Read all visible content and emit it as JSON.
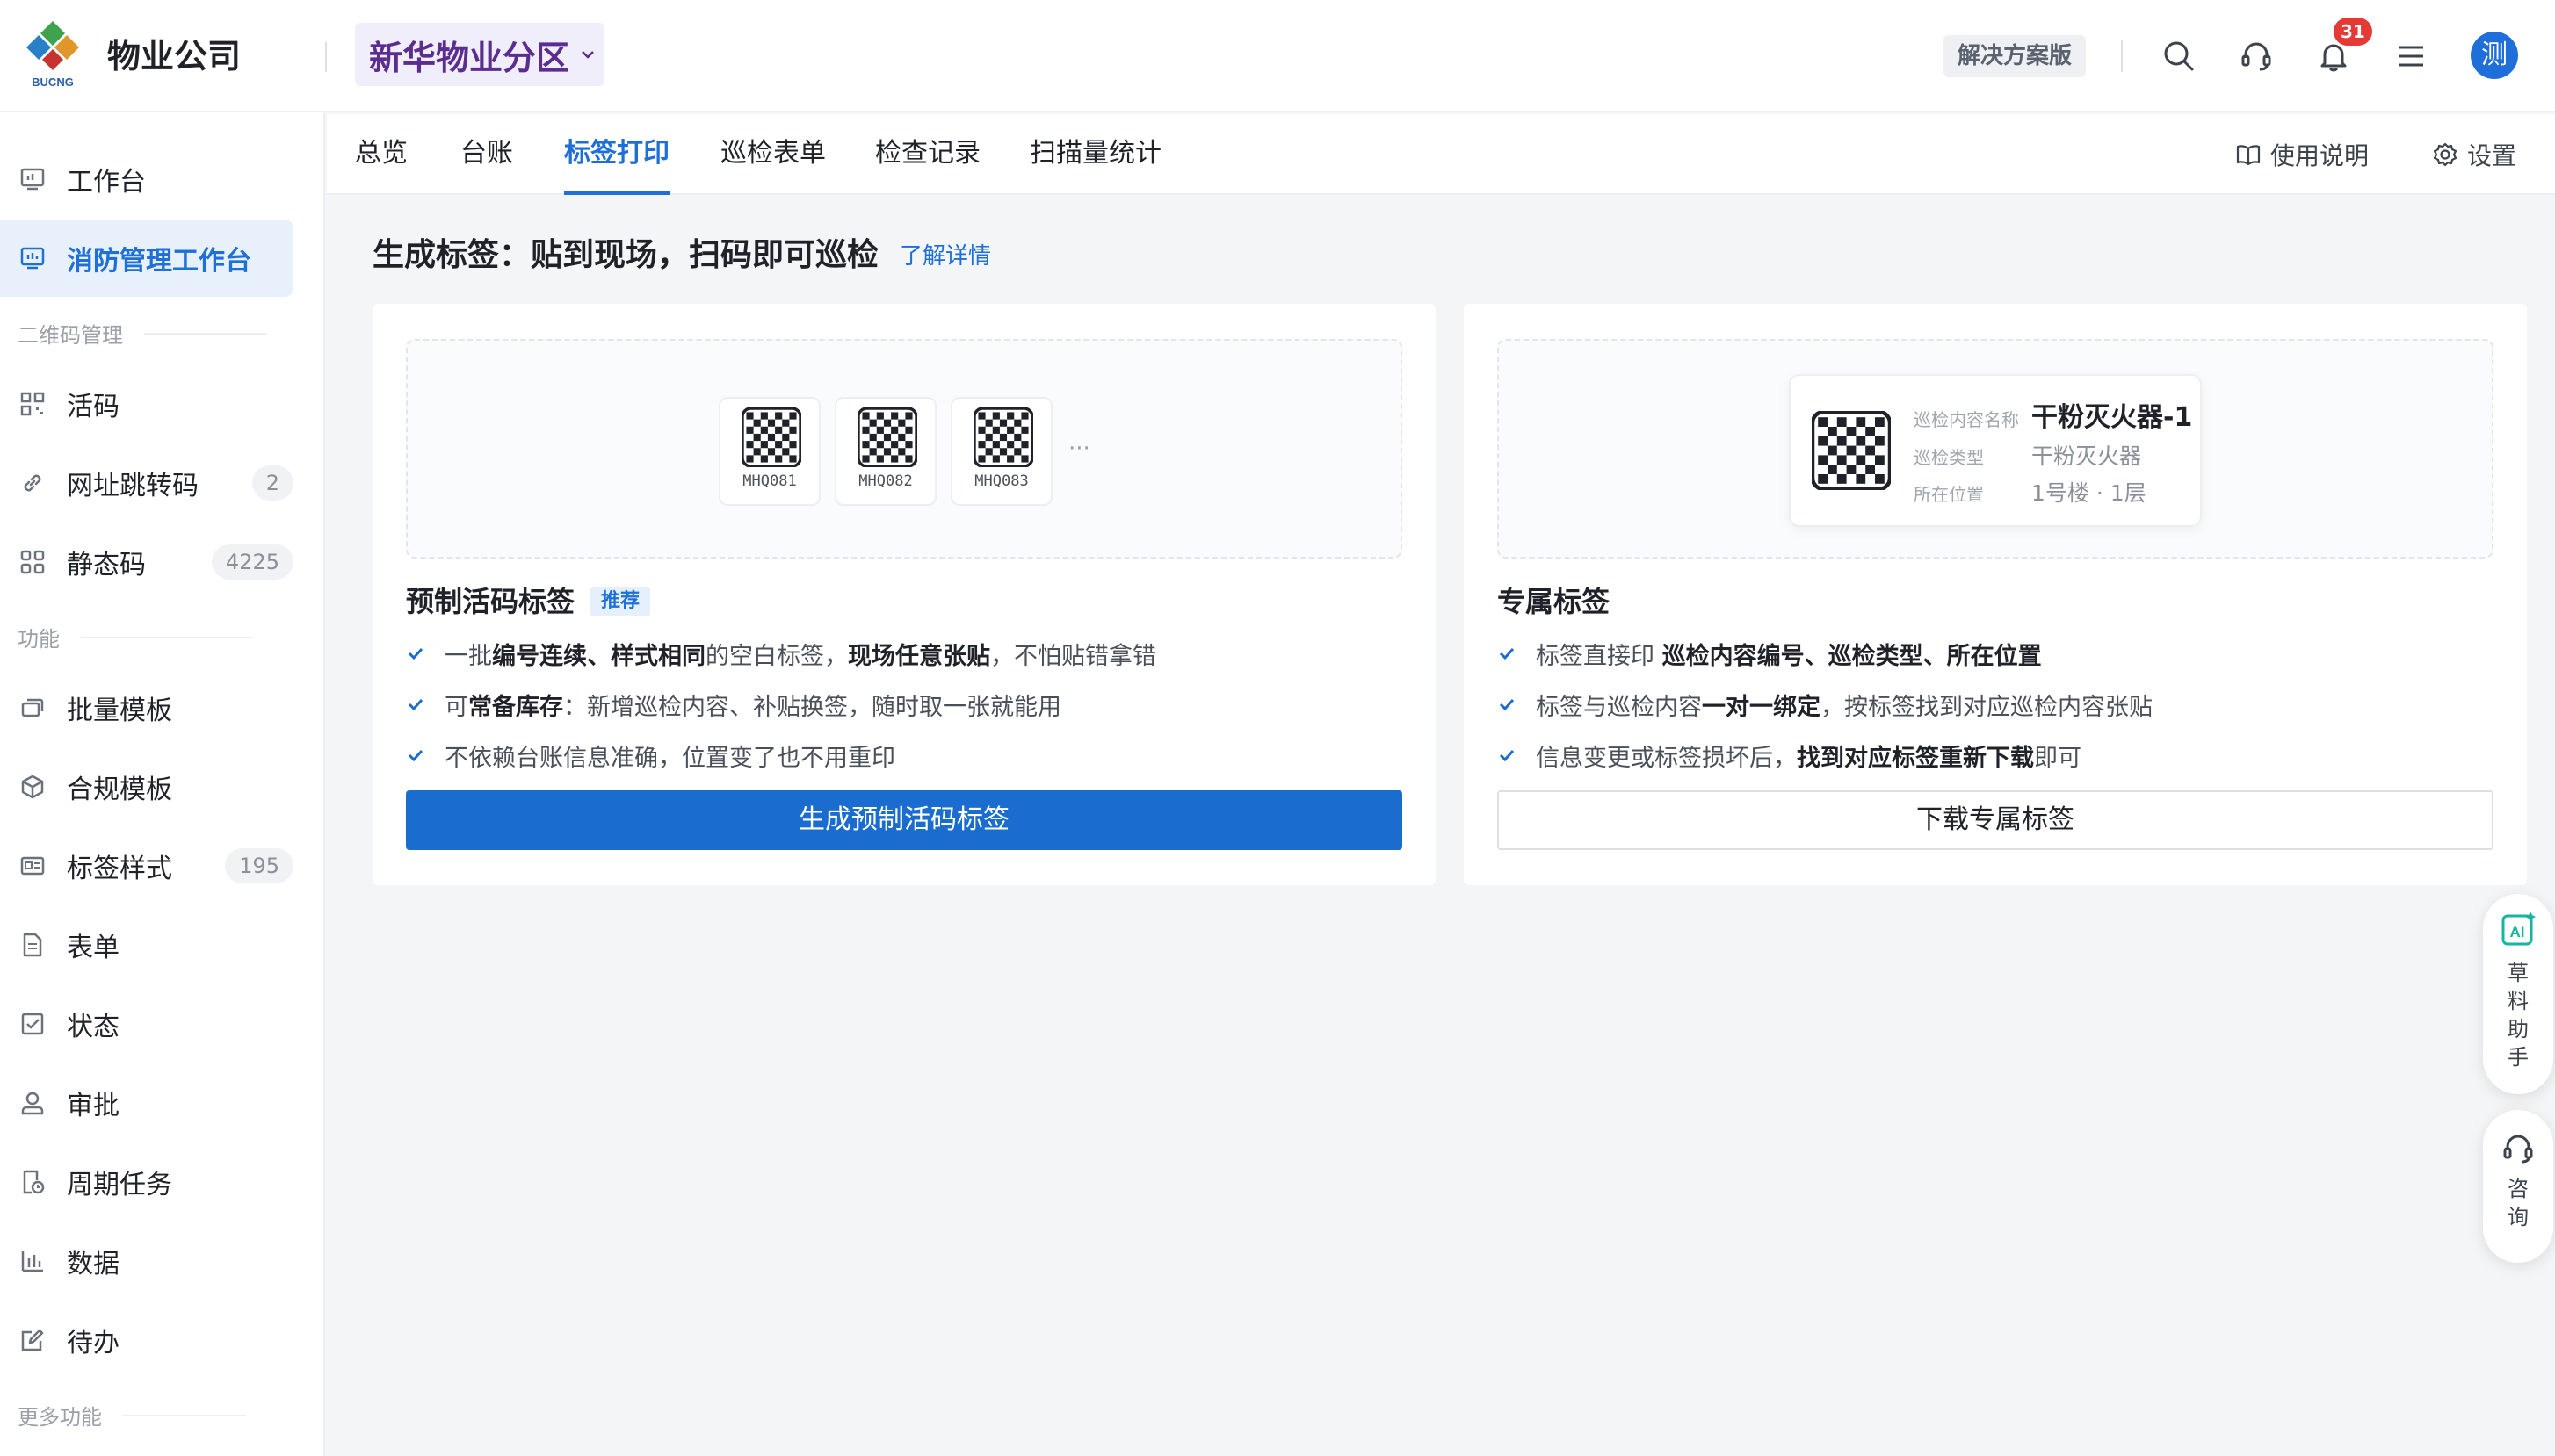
{
  "header": {
    "company": "物业公司",
    "logo_text": "BUCNG",
    "org_name": "新华物业分区",
    "edition": "解决方案版",
    "notification_count": "31",
    "avatar_text": "测"
  },
  "sidebar": {
    "items": [
      {
        "label": "工作台"
      },
      {
        "label": "消防管理工作台"
      },
      {
        "label": "活码"
      },
      {
        "label": "网址跳转码",
        "count": "2"
      },
      {
        "label": "静态码",
        "count": "4225"
      },
      {
        "label": "批量模板"
      },
      {
        "label": "合规模板"
      },
      {
        "label": "标签样式",
        "count": "195"
      },
      {
        "label": "表单"
      },
      {
        "label": "状态"
      },
      {
        "label": "审批"
      },
      {
        "label": "周期任务"
      },
      {
        "label": "数据"
      },
      {
        "label": "待办"
      }
    ],
    "groups": [
      "二维码管理",
      "功能",
      "更多功能"
    ]
  },
  "subnav": {
    "tabs": [
      "总览",
      "台账",
      "标签打印",
      "巡检表单",
      "检查记录",
      "扫描量统计"
    ],
    "active_tab": "标签打印",
    "help_label": "使用说明",
    "settings_label": "设置"
  },
  "main": {
    "title": "生成标签：贴到现场，扫码即可巡检",
    "learn_more": "了解详情",
    "card_left": {
      "sample_codes": [
        "MHQ081",
        "MHQ082",
        "MHQ083"
      ],
      "more": "···",
      "title": "预制活码标签",
      "tag": "推荐",
      "bullets": [
        [
          {
            "t": "一批",
            "b": false
          },
          {
            "t": "编号连续、样式相同",
            "b": true
          },
          {
            "t": "的空白标签，",
            "b": false
          },
          {
            "t": "现场任意张贴",
            "b": true
          },
          {
            "t": "，不怕贴错拿错",
            "b": false
          }
        ],
        [
          {
            "t": "可",
            "b": false
          },
          {
            "t": "常备库存",
            "b": true
          },
          {
            "t": "：新增巡检内容、补贴换签，随时取一张就能用",
            "b": false
          }
        ],
        [
          {
            "t": "不依赖台账信息准确，位置变了也不用重印",
            "b": false
          }
        ]
      ],
      "button": "生成预制活码标签"
    },
    "card_right": {
      "sample": {
        "name_key": "巡检内容名称",
        "name_value": "干粉灭火器-1",
        "type_key": "巡检类型",
        "type_value": "干粉灭火器",
        "loc_key": "所在位置",
        "loc_value": "1号楼 · 1层"
      },
      "title": "专属标签",
      "bullets": [
        [
          {
            "t": "标签直接印 ",
            "b": false
          },
          {
            "t": "巡检内容编号、巡检类型、所在位置",
            "b": true
          }
        ],
        [
          {
            "t": "标签与巡检内容",
            "b": false
          },
          {
            "t": "一对一绑定",
            "b": true
          },
          {
            "t": "，按标签找到对应巡检内容张贴",
            "b": false
          }
        ],
        [
          {
            "t": "信息变更或标签损坏后，",
            "b": false
          },
          {
            "t": "找到对应标签重新下载",
            "b": true
          },
          {
            "t": "即可",
            "b": false
          }
        ]
      ],
      "button": "下载专属标签"
    }
  },
  "floating": {
    "ai_label": "草料助手",
    "consult_label": "咨询"
  },
  "colors": {
    "primary": "#1a6ccf",
    "org_text": "#5b2d8f",
    "badge": "#e53935"
  }
}
